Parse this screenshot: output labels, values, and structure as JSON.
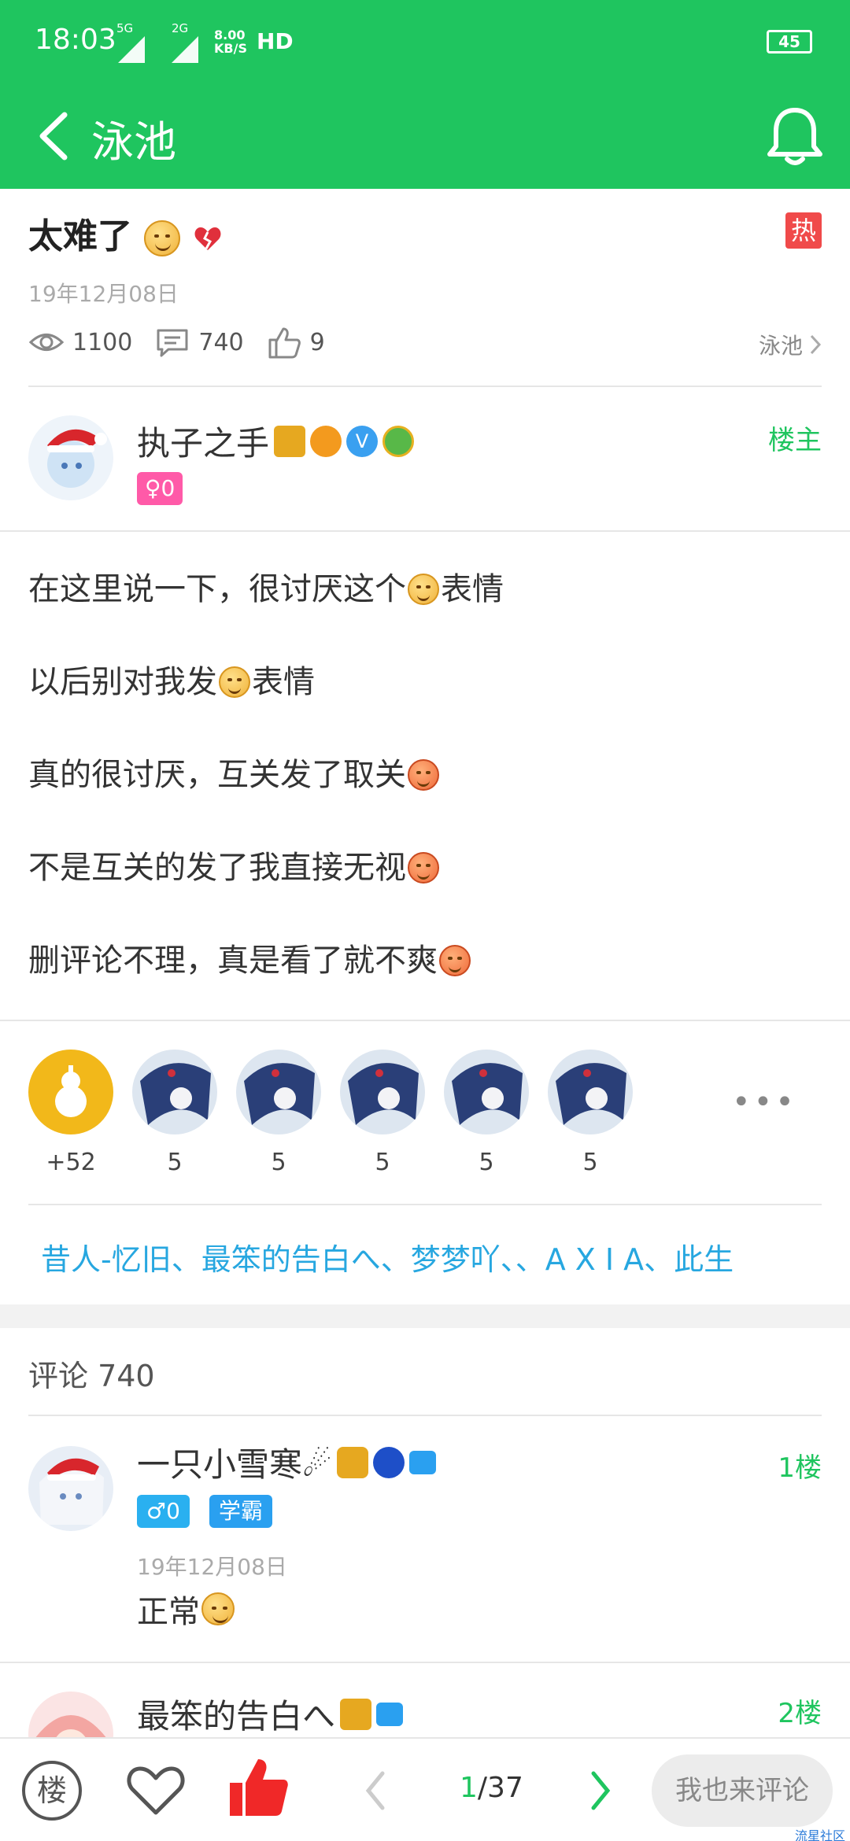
{
  "status_bar": {
    "time": "18:03",
    "signal1": "5G",
    "signal2": "2G",
    "speed_top": "8.00",
    "speed_bottom": "KB/S",
    "hd": "HD",
    "battery": "45"
  },
  "header": {
    "title": "泳池",
    "accent_color": "#1fc55f"
  },
  "post": {
    "title": "太难了",
    "hot_badge": "热",
    "date": "19年12月08日",
    "views": "1100",
    "comments": "740",
    "likes": "9",
    "board": "泳池"
  },
  "author": {
    "name": "执子之手",
    "gender_badge": "♀0",
    "role": "楼主"
  },
  "content": {
    "line1_pre": "在这里说一下，很讨厌这个",
    "line1_post": "表情",
    "line2_pre": "以后别对我发",
    "line2_post": "表情",
    "line3": "真的很讨厌，互关发了取关",
    "line4": "不是互关的发了我直接无视",
    "line5": "删评论不理，真是看了就不爽"
  },
  "likers": {
    "first_count": "+52",
    "counts": [
      "5",
      "5",
      "5",
      "5",
      "5"
    ],
    "more": "•••",
    "names": "昔人-忆旧、最笨的告白へ、梦梦吖、、A X I A、此生"
  },
  "comments": {
    "header": "评论 740",
    "items": [
      {
        "name": "一只小雪寒☄",
        "gender_badge": "♂0",
        "title_badge": "学霸",
        "floor": "1楼",
        "date": "19年12月08日",
        "text": "正常"
      },
      {
        "name": "最笨的告白へ",
        "floor": "2楼"
      }
    ]
  },
  "bottom_bar": {
    "floor_button": "楼",
    "page_current": "1",
    "page_total": "/37",
    "comment_placeholder": "我也来评论"
  },
  "watermark": "流星社区"
}
